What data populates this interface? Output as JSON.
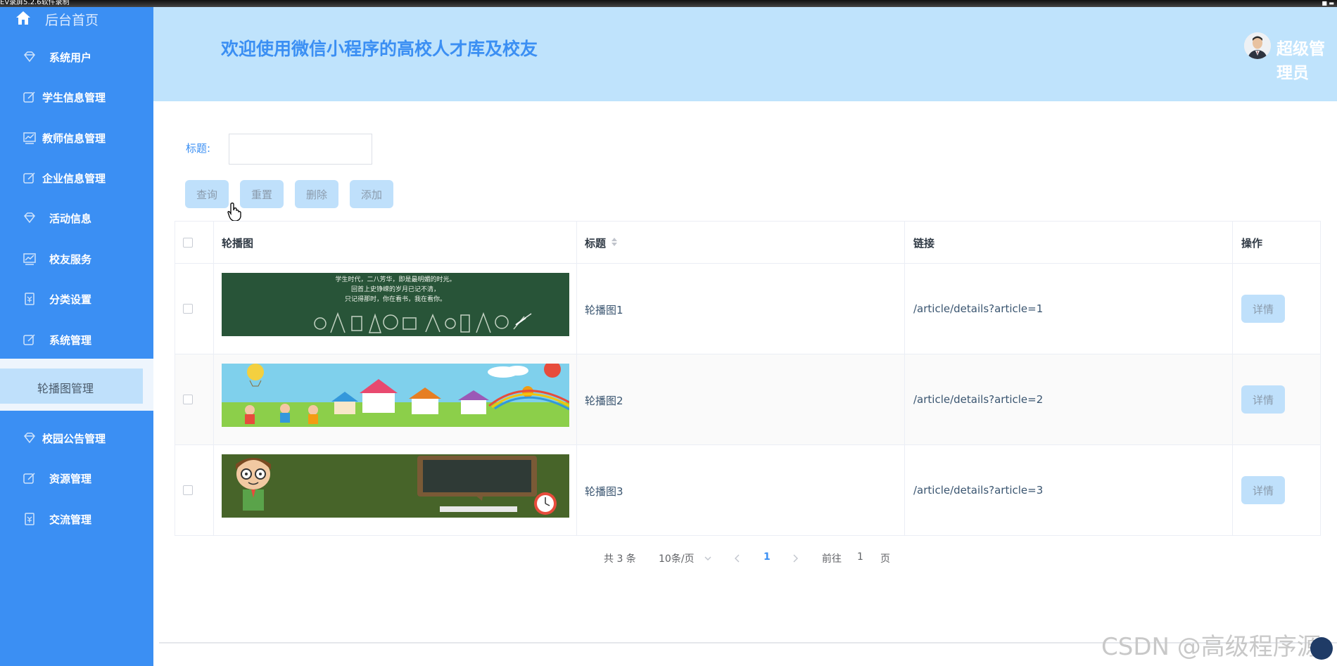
{
  "recorder": {
    "text": "EV录屏5.2.6软件录制"
  },
  "sidebar": {
    "home": {
      "label": "后台首页",
      "icon": "home-icon"
    },
    "items": [
      {
        "label": "系统用户",
        "icon": "gem-icon"
      },
      {
        "label": "学生信息管理",
        "icon": "edit-icon"
      },
      {
        "label": "教师信息管理",
        "icon": "chart-icon"
      },
      {
        "label": "企业信息管理",
        "icon": "edit-icon"
      },
      {
        "label": "活动信息",
        "icon": "gem-icon"
      },
      {
        "label": "校友服务",
        "icon": "chart-icon"
      },
      {
        "label": "分类设置",
        "icon": "bookmark-icon"
      },
      {
        "label": "系统管理",
        "icon": "edit-icon"
      },
      {
        "label": "校园公告管理",
        "icon": "gem-icon"
      },
      {
        "label": "资源管理",
        "icon": "edit-icon"
      },
      {
        "label": "交流管理",
        "icon": "bookmark-icon"
      }
    ],
    "sub_item": {
      "label": "轮播图管理"
    }
  },
  "header": {
    "title": "欢迎使用微信小程序的高校人才库及校友",
    "user": "超级管理员"
  },
  "search": {
    "label": "标题:",
    "value": ""
  },
  "toolbar": {
    "query": "查询",
    "reset": "重置",
    "delete": "删除",
    "add": "添加"
  },
  "table": {
    "columns": [
      "轮播图",
      "标题",
      "链接",
      "操作"
    ],
    "rows": [
      {
        "title": "轮播图1",
        "link": "/article/details?article=1",
        "action": "详情",
        "image": "chalkboard"
      },
      {
        "title": "轮播图2",
        "link": "/article/details?article=2",
        "action": "详情",
        "image": "cartoon-town"
      },
      {
        "title": "轮播图3",
        "link": "/article/details?article=3",
        "action": "详情",
        "image": "teacher-blackboard"
      }
    ],
    "banner_text": [
      "学生时代，二八芳华，即是最明媚的时光。",
      "回首上史铮嵘的岁月已记不清，",
      "只记得那时，你在看书，我在看你。"
    ]
  },
  "pagination": {
    "total": "共 3 条",
    "page_size": "10条/页",
    "current": "1",
    "goto_prefix": "前往",
    "goto_value": "1",
    "goto_suffix": "页"
  },
  "watermark": "CSDN @高级程序源",
  "colors": {
    "sidebar": "#3b8ff3",
    "header": "#bfe3fc",
    "button": "#bfe0fb",
    "accent": "#3b8ff3"
  }
}
